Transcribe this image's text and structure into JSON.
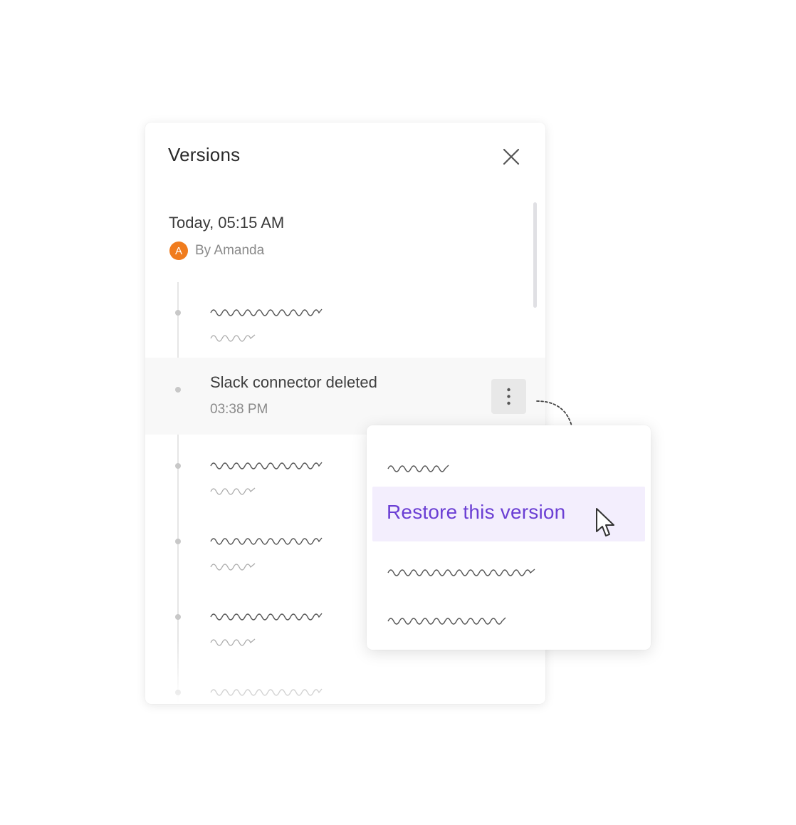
{
  "panel": {
    "title": "Versions",
    "close_icon": "close-icon"
  },
  "version": {
    "date": "Today, 05:15 AM",
    "author_initial": "A",
    "author_text": "By Amanda",
    "avatar_color": "#f07c1e"
  },
  "change": {
    "title": "Slack connector deleted",
    "time": "03:38 PM",
    "more_icon": "more-vertical-icon"
  },
  "menu": {
    "restore_label": "Restore this version"
  },
  "colors": {
    "accent": "#6b3fd4",
    "accent_bg": "#f3eefd",
    "avatar": "#f07c1e",
    "row_highlight": "#f8f8f8"
  }
}
